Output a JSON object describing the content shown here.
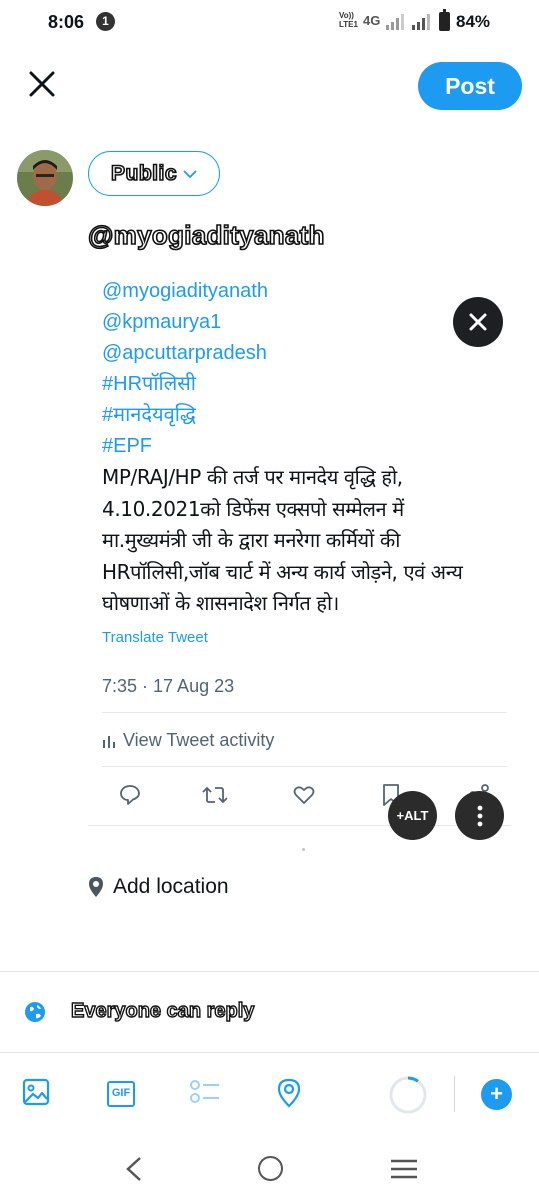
{
  "status_bar": {
    "time": "8:06",
    "notification_count": "1",
    "volte_label": "Vo)) LTE1",
    "network": "4G",
    "battery": "84%"
  },
  "header": {
    "close_icon": "close-icon",
    "post_label": "Post"
  },
  "composer": {
    "audience_label": "Public",
    "text": "@myogiadityanath"
  },
  "quoted_tweet": {
    "mentions": [
      "@myogiadityanath",
      "@kpmaurya1",
      "@apcuttarpradesh",
      "#HRपॉलिसी",
      "#मानदेयवृद्धि",
      "#EPF"
    ],
    "body_lines": [
      "MP/RAJ/HP की तर्ज पर मानदेय वृद्धि हो,",
      "4.10.2021को डिफेंस एक्सपो सम्मेलन में",
      "मा.मुख्यमंत्री जी के द्वारा मनरेगा कर्मियों की",
      "HRपॉलिसी,जॉब चार्ट में अन्य कार्य जोड़ने, एवं अन्य",
      "घोषणाओं के शासनादेश निर्गत हो।"
    ],
    "translate_label": "Translate Tweet",
    "timestamp": "7:35 · 17 Aug 23",
    "activity_label": "View Tweet activity"
  },
  "media_overlay": {
    "alt_label": "+ALT"
  },
  "location": {
    "label": "Add location"
  },
  "reply_setting": {
    "label": "Everyone can reply"
  },
  "toolbar": {
    "gif_label": "GIF",
    "add_label": "+"
  },
  "colors": {
    "accent": "#1d9bf0",
    "text": "#0f1419",
    "secondary": "#536471"
  }
}
